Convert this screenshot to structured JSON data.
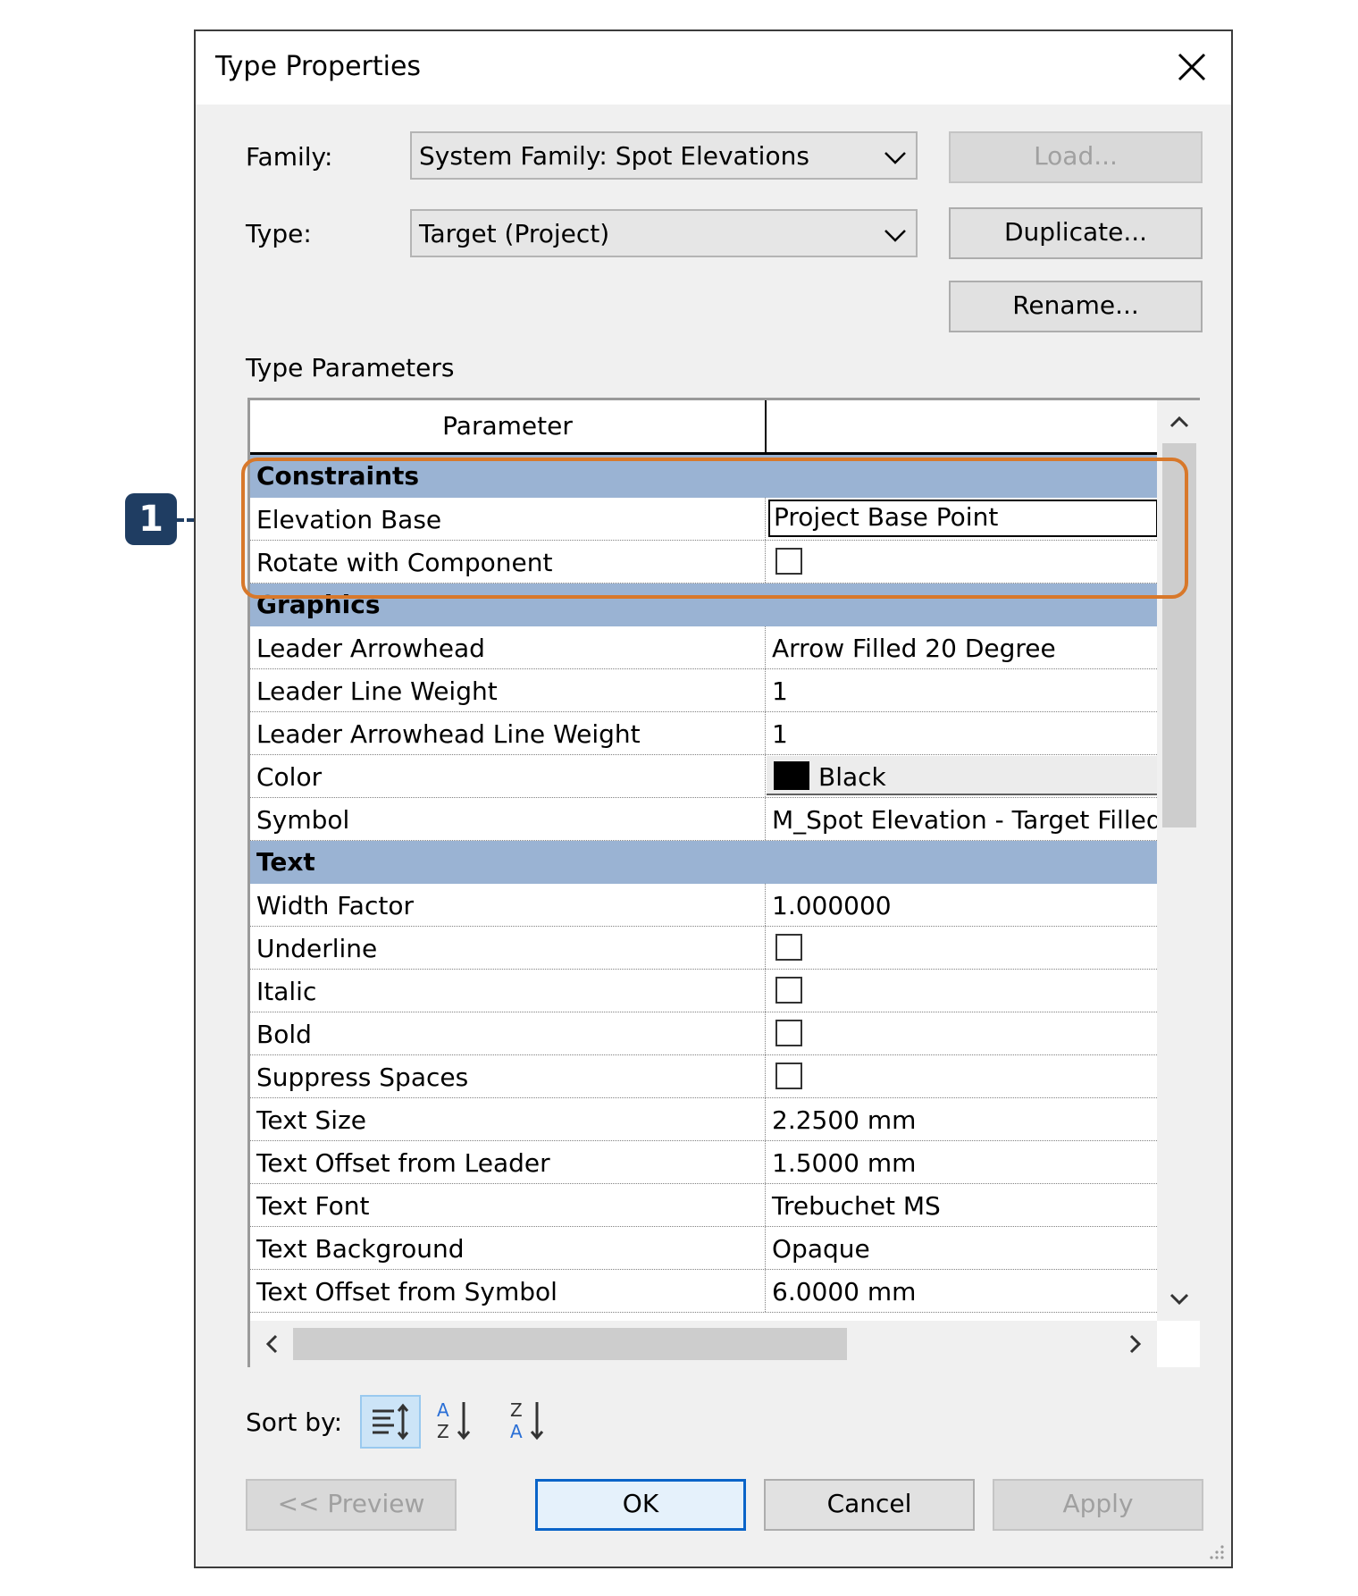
{
  "dialog": {
    "title": "Type Properties",
    "family_label": "Family:",
    "family_value": "System Family: Spot Elevations",
    "type_label": "Type:",
    "type_value": "Target (Project)",
    "load_button": "Load...",
    "duplicate_button": "Duplicate...",
    "rename_button": "Rename...",
    "section_label": "Type Parameters",
    "sort_label": "Sort by:",
    "preview_button": "<< Preview",
    "ok_button": "OK",
    "cancel_button": "Cancel",
    "apply_button": "Apply"
  },
  "grid": {
    "header_parameter": "Parameter",
    "groups": [
      {
        "name": "Constraints",
        "rows": [
          {
            "name": "Elevation Base",
            "value": "Project Base Point"
          },
          {
            "name": "Rotate with Component",
            "checked": false
          }
        ]
      },
      {
        "name": "Graphics",
        "rows": [
          {
            "name": "Leader Arrowhead",
            "value": "Arrow Filled 20 Degree"
          },
          {
            "name": "Leader Line Weight",
            "value": "1"
          },
          {
            "name": "Leader Arrowhead Line Weight",
            "value": "1"
          },
          {
            "name": "Color",
            "value": "Black",
            "swatch": "#000000"
          },
          {
            "name": "Symbol",
            "value": "M_Spot Elevation - Target Filled"
          }
        ]
      },
      {
        "name": "Text",
        "rows": [
          {
            "name": "Width Factor",
            "value": "1.000000"
          },
          {
            "name": "Underline",
            "checked": false
          },
          {
            "name": "Italic",
            "checked": false
          },
          {
            "name": "Bold",
            "checked": false
          },
          {
            "name": "Suppress Spaces",
            "checked": false
          },
          {
            "name": "Text Size",
            "value": "2.2500 mm"
          },
          {
            "name": "Text Offset from Leader",
            "value": "1.5000 mm"
          },
          {
            "name": "Text Font",
            "value": "Trebuchet MS"
          },
          {
            "name": "Text Background",
            "value": "Opaque"
          },
          {
            "name": "Text Offset from Symbol",
            "value": "6.0000 mm"
          }
        ]
      }
    ]
  },
  "annotation": {
    "callout_number": "1",
    "highlight_color": "#d8782a",
    "callout_color": "#1f3d62"
  },
  "colors": {
    "group_header": "#9ab3d3",
    "default_button_border": "#0a64c8"
  }
}
